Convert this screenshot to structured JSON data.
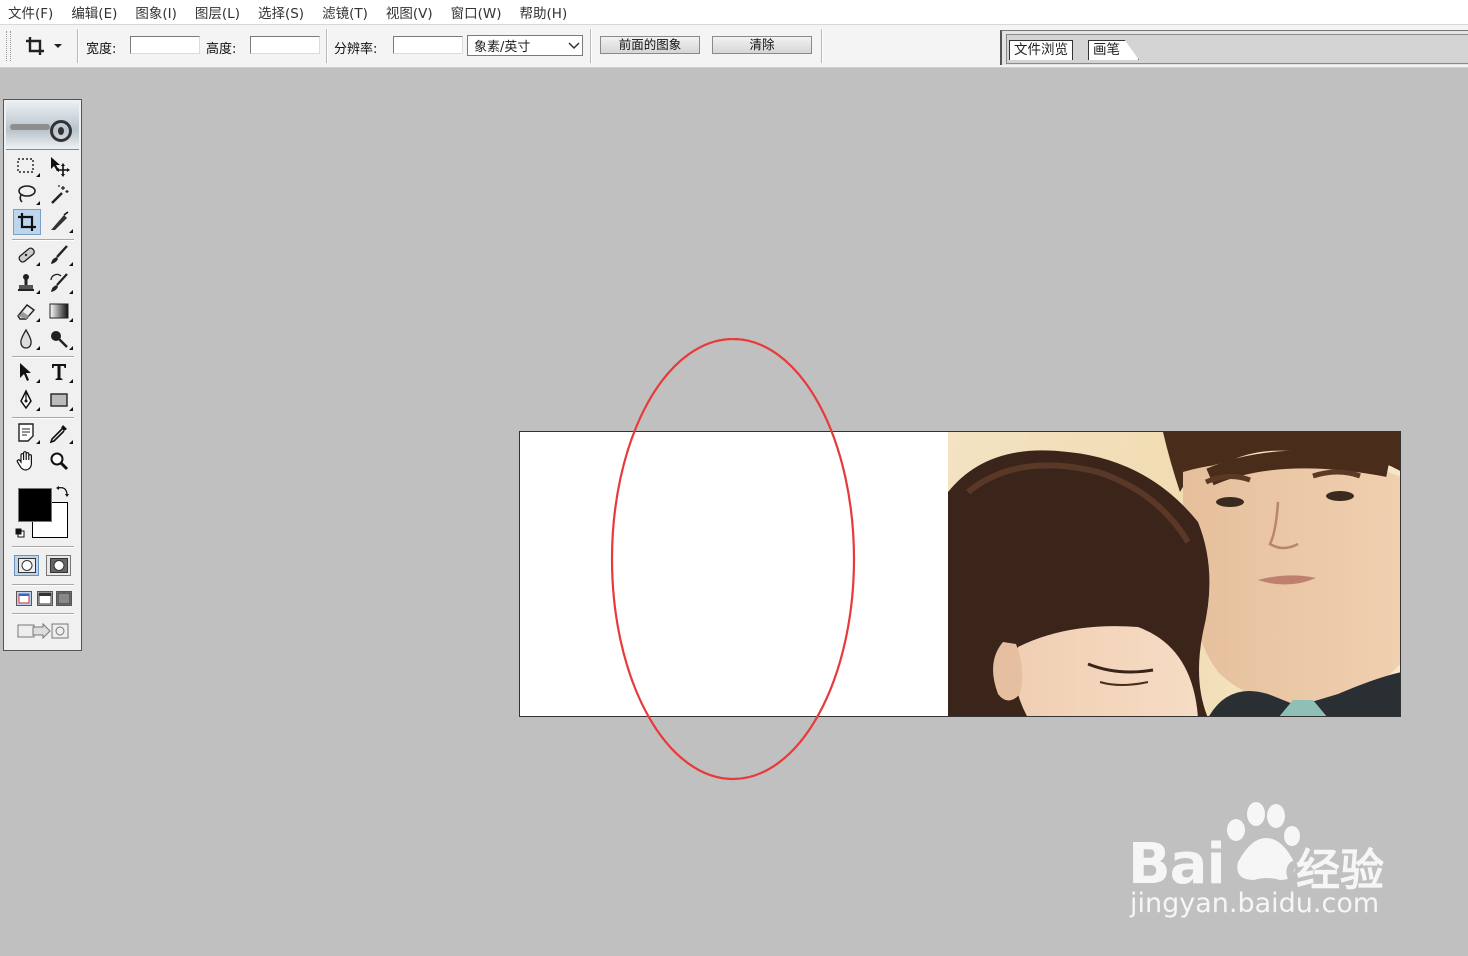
{
  "menu": [
    "文件(F)",
    "编辑(E)",
    "图象(I)",
    "图层(L)",
    "选择(S)",
    "滤镜(T)",
    "视图(V)",
    "窗口(W)",
    "帮助(H)"
  ],
  "options": {
    "width_label": "宽度:",
    "width_value": "",
    "height_label": "高度:",
    "height_value": "",
    "resolution_label": "分辨率:",
    "resolution_value": "",
    "unit_selected": "象素/英寸",
    "front_image_button": "前面的图象",
    "clear_button": "清除"
  },
  "palette_well": {
    "tabs": [
      "文件浏览",
      "画笔"
    ]
  },
  "toolbox": {
    "active_tool": "crop-tool",
    "foreground_color": "#000000",
    "background_color": "#ffffff"
  },
  "canvas": {
    "annotation_color": "#e83a3a"
  },
  "watermark": {
    "logo": "Bai",
    "logo_suffix": "du",
    "brand": "经验",
    "url": "jingyan.baidu.com"
  }
}
